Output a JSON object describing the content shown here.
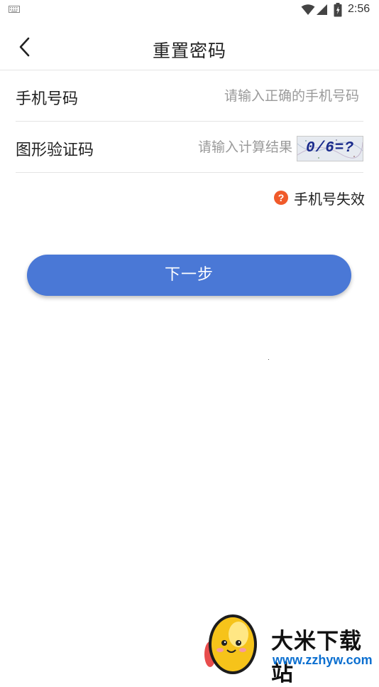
{
  "status_bar": {
    "time": "2:56",
    "icons": [
      "keyboard-icon",
      "wifi-icon",
      "signal-icon",
      "battery-icon"
    ]
  },
  "header": {
    "title": "重置密码",
    "back_icon": "chevron-left-icon"
  },
  "form": {
    "phone": {
      "label": "手机号码",
      "value": "",
      "placeholder": "请输入正确的手机号码"
    },
    "captcha": {
      "label": "图形验证码",
      "value": "",
      "placeholder": "请输入计算结果",
      "image_text": "0/6=?"
    }
  },
  "error_hint": {
    "icon": "question-circle-icon",
    "text": "手机号失效"
  },
  "next_button": {
    "label": "下一步"
  },
  "watermark": {
    "title": "大米下载站",
    "url": "www.zzhyw.com"
  },
  "colors": {
    "primary": "#4a78d6",
    "hint_icon": "#f05a2a",
    "divider": "#e4e4e4",
    "watermark_url": "#0b6fd0"
  }
}
